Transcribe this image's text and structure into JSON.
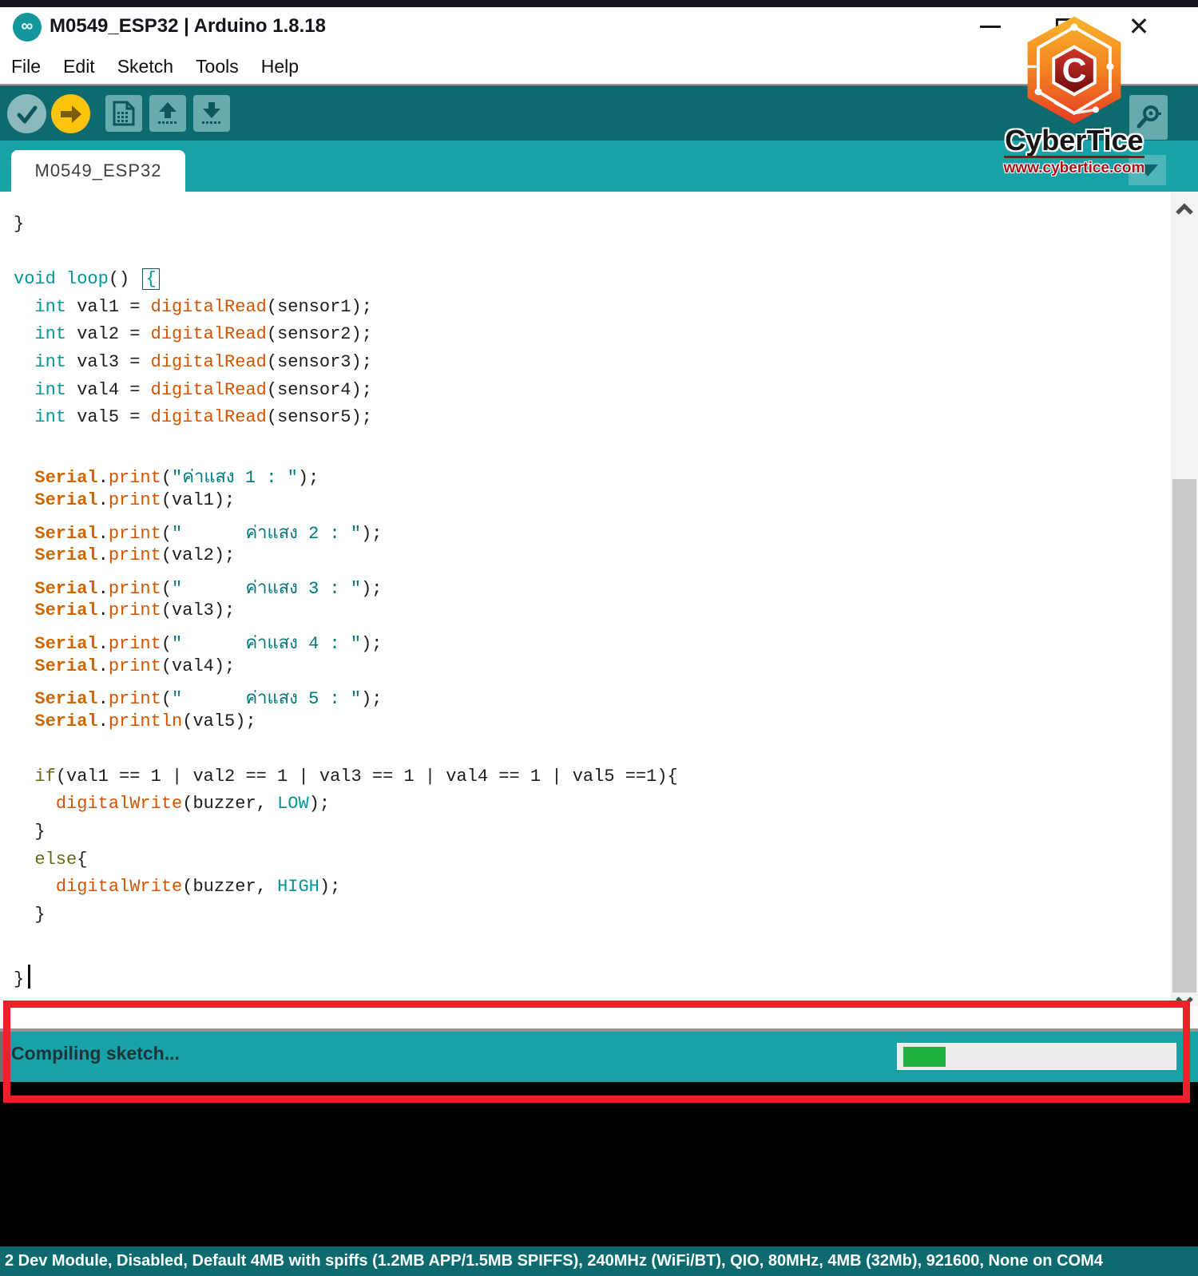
{
  "window": {
    "title": "M0549_ESP32 | Arduino 1.8.18",
    "controls": {
      "minimize": "",
      "maximize": "",
      "close": "✕"
    }
  },
  "menu": {
    "items": [
      "File",
      "Edit",
      "Sketch",
      "Tools",
      "Help"
    ]
  },
  "toolbar": {
    "buttons": [
      "verify",
      "upload",
      "new-sketch",
      "open",
      "save",
      "serial-monitor"
    ]
  },
  "tabs": {
    "active_label": "M0549_ESP32"
  },
  "editor": {
    "lines": [
      [
        [
          "p",
          "}"
        ]
      ],
      [],
      [
        [
          "k",
          "void"
        ],
        [
          "p",
          " "
        ],
        [
          "k",
          "loop"
        ],
        [
          "p",
          "() "
        ],
        [
          "B",
          "{"
        ]
      ],
      [
        [
          "p",
          "  "
        ],
        [
          "k",
          "int"
        ],
        [
          "p",
          " val1 = "
        ],
        [
          "f",
          "digitalRead"
        ],
        [
          "p",
          "(sensor1);"
        ]
      ],
      [
        [
          "p",
          "  "
        ],
        [
          "k",
          "int"
        ],
        [
          "p",
          " val2 = "
        ],
        [
          "f",
          "digitalRead"
        ],
        [
          "p",
          "(sensor2);"
        ]
      ],
      [
        [
          "p",
          "  "
        ],
        [
          "k",
          "int"
        ],
        [
          "p",
          " val3 = "
        ],
        [
          "f",
          "digitalRead"
        ],
        [
          "p",
          "(sensor3);"
        ]
      ],
      [
        [
          "p",
          "  "
        ],
        [
          "k",
          "int"
        ],
        [
          "p",
          " val4 = "
        ],
        [
          "f",
          "digitalRead"
        ],
        [
          "p",
          "(sensor4);"
        ]
      ],
      [
        [
          "p",
          "  "
        ],
        [
          "k",
          "int"
        ],
        [
          "p",
          " val5 = "
        ],
        [
          "f",
          "digitalRead"
        ],
        [
          "p",
          "(sensor5);"
        ]
      ],
      [],
      [
        [
          "p",
          "  "
        ],
        [
          "S",
          "Serial"
        ],
        [
          "p",
          "."
        ],
        [
          "f",
          "print"
        ],
        [
          "p",
          "("
        ],
        [
          "s",
          "\"ค่าแสง 1 : \""
        ],
        [
          "p",
          ");"
        ]
      ],
      [
        [
          "p",
          "  "
        ],
        [
          "S",
          "Serial"
        ],
        [
          "p",
          "."
        ],
        [
          "f",
          "print"
        ],
        [
          "p",
          "(val1);"
        ]
      ],
      [
        [
          "p",
          "  "
        ],
        [
          "S",
          "Serial"
        ],
        [
          "p",
          "."
        ],
        [
          "f",
          "print"
        ],
        [
          "p",
          "("
        ],
        [
          "s",
          "\"      ค่าแสง 2 : \""
        ],
        [
          "p",
          ");"
        ]
      ],
      [
        [
          "p",
          "  "
        ],
        [
          "S",
          "Serial"
        ],
        [
          "p",
          "."
        ],
        [
          "f",
          "print"
        ],
        [
          "p",
          "(val2);"
        ]
      ],
      [
        [
          "p",
          "  "
        ],
        [
          "S",
          "Serial"
        ],
        [
          "p",
          "."
        ],
        [
          "f",
          "print"
        ],
        [
          "p",
          "("
        ],
        [
          "s",
          "\"      ค่าแสง 3 : \""
        ],
        [
          "p",
          ");"
        ]
      ],
      [
        [
          "p",
          "  "
        ],
        [
          "S",
          "Serial"
        ],
        [
          "p",
          "."
        ],
        [
          "f",
          "print"
        ],
        [
          "p",
          "(val3);"
        ]
      ],
      [
        [
          "p",
          "  "
        ],
        [
          "S",
          "Serial"
        ],
        [
          "p",
          "."
        ],
        [
          "f",
          "print"
        ],
        [
          "p",
          "("
        ],
        [
          "s",
          "\"      ค่าแสง 4 : \""
        ],
        [
          "p",
          ");"
        ]
      ],
      [
        [
          "p",
          "  "
        ],
        [
          "S",
          "Serial"
        ],
        [
          "p",
          "."
        ],
        [
          "f",
          "print"
        ],
        [
          "p",
          "(val4);"
        ]
      ],
      [
        [
          "p",
          "  "
        ],
        [
          "S",
          "Serial"
        ],
        [
          "p",
          "."
        ],
        [
          "f",
          "print"
        ],
        [
          "p",
          "("
        ],
        [
          "s",
          "\"      ค่าแสง 5 : \""
        ],
        [
          "p",
          ");"
        ]
      ],
      [
        [
          "p",
          "  "
        ],
        [
          "S",
          "Serial"
        ],
        [
          "p",
          "."
        ],
        [
          "f",
          "println"
        ],
        [
          "p",
          "(val5);"
        ]
      ],
      [],
      [
        [
          "p",
          "  "
        ],
        [
          "c",
          "if"
        ],
        [
          "p",
          "(val1 == 1 | val2 == 1 | val3 == 1 | val4 == 1 | val5 ==1){"
        ]
      ],
      [
        [
          "p",
          "    "
        ],
        [
          "f",
          "digitalWrite"
        ],
        [
          "p",
          "(buzzer, "
        ],
        [
          "l",
          "LOW"
        ],
        [
          "p",
          ");"
        ]
      ],
      [
        [
          "p",
          "  }"
        ]
      ],
      [
        [
          "p",
          "  "
        ],
        [
          "c",
          "else"
        ],
        [
          "p",
          "{"
        ]
      ],
      [
        [
          "p",
          "    "
        ],
        [
          "f",
          "digitalWrite"
        ],
        [
          "p",
          "(buzzer, "
        ],
        [
          "l",
          "HIGH"
        ],
        [
          "p",
          ");"
        ]
      ],
      [
        [
          "p",
          "  }"
        ]
      ],
      [],
      [
        [
          "p",
          "}"
        ],
        [
          "caret",
          ""
        ]
      ]
    ]
  },
  "status": {
    "message": "Compiling sketch...",
    "progress_percent": 16
  },
  "board_info": {
    "text": "2 Dev Module, Disabled, Default 4MB with spiffs (1.2MB APP/1.5MB SPIFFS), 240MHz (WiFi/BT), QIO, 80MHz, 4MB (32Mb), 921600, None on COM4"
  },
  "watermark": {
    "brand": "CyberTice",
    "url": "www.cybertice.com"
  },
  "colors": {
    "toolbar_teal": "#0d6b70",
    "bar_teal": "#18a2a7",
    "upload_yellow": "#fdc40e",
    "progress_green": "#1fb13f",
    "annotation_red": "#e9232b",
    "keyword_teal": "#00979c",
    "function_orange": "#d35400",
    "serial_orange": "#cc6600",
    "string_teal": "#00797e",
    "control_olive": "#6b6a14"
  }
}
